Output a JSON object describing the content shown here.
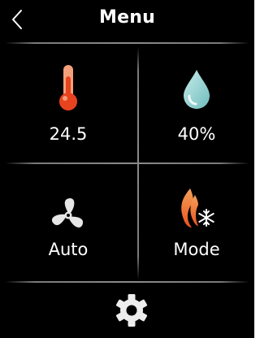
{
  "header": {
    "title": "Menu",
    "back_icon": "chevron-left-icon"
  },
  "tiles": {
    "temperature": {
      "value": "24.5",
      "icon": "thermometer-icon",
      "icon_color": "#f2542d"
    },
    "humidity": {
      "value": "40%",
      "icon": "water-drop-icon",
      "icon_color": "#9fd8d8"
    },
    "fan": {
      "value": "Auto",
      "icon": "fan-icon"
    },
    "mode": {
      "value": "Mode",
      "icon": "flame-snowflake-icon"
    }
  },
  "footer": {
    "settings_icon": "gear-icon"
  },
  "colors": {
    "background": "#000000",
    "text": "#ffffff",
    "divider": "#808080"
  }
}
